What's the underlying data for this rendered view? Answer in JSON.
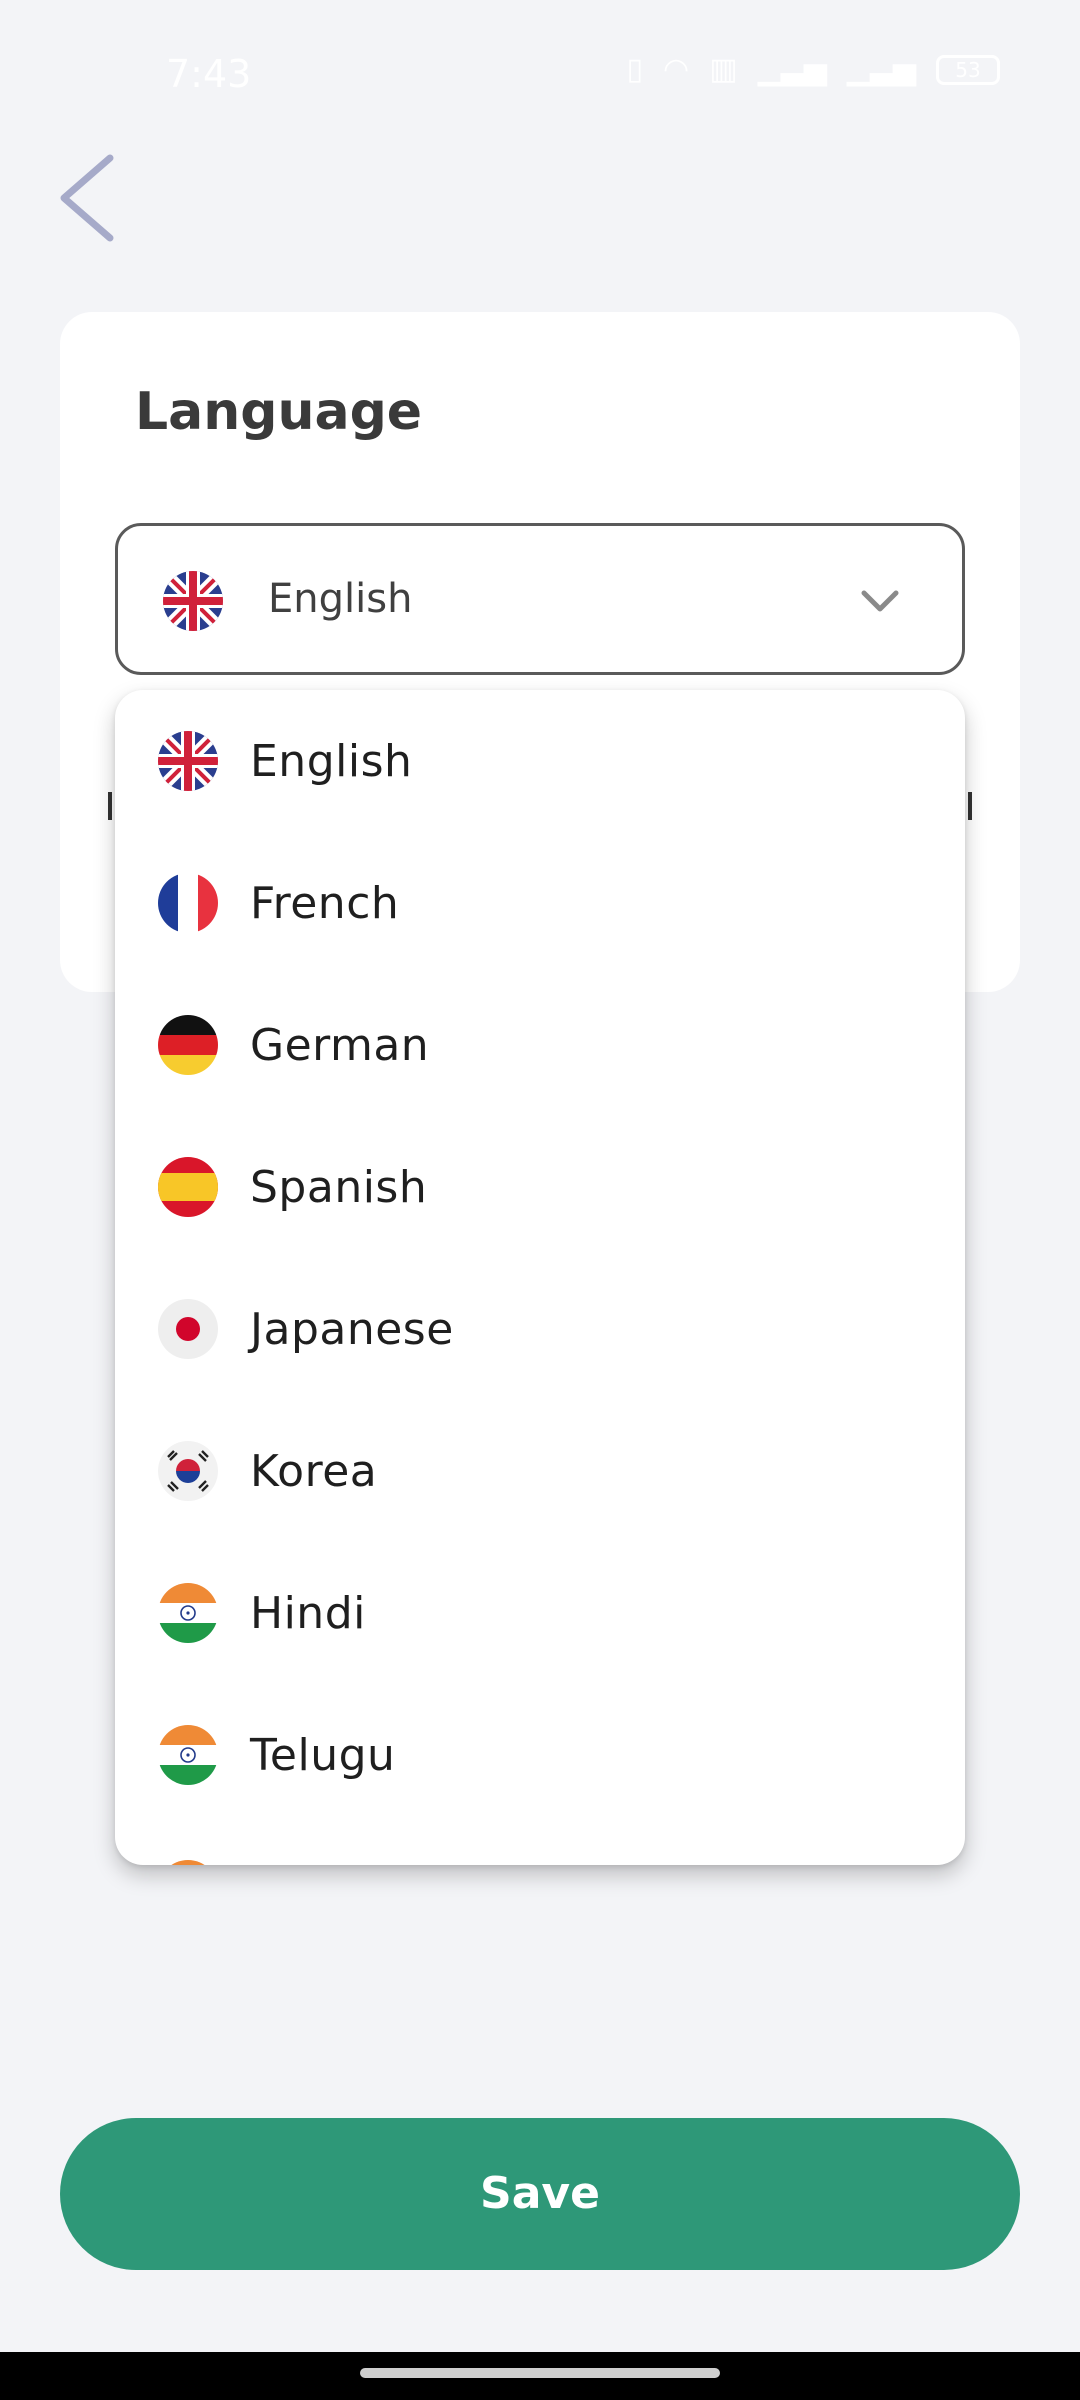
{
  "status_bar": {
    "time": "7:43",
    "icons": [
      "vibrate-icon",
      "wifi-icon",
      "data-icon",
      "signal-icon",
      "signal-icon"
    ],
    "battery": "53"
  },
  "page": {
    "title": "Language",
    "back_icon": "chevron-left-icon"
  },
  "select": {
    "selected_value": "English",
    "selected_flag": "uk-flag-icon"
  },
  "dropdown": {
    "options": [
      {
        "label": "English",
        "flag": "uk-flag-icon"
      },
      {
        "label": "French",
        "flag": "france-flag-icon"
      },
      {
        "label": "German",
        "flag": "germany-flag-icon"
      },
      {
        "label": "Spanish",
        "flag": "spain-flag-icon"
      },
      {
        "label": "Japanese",
        "flag": "japan-flag-icon"
      },
      {
        "label": "Korea",
        "flag": "korea-flag-icon"
      },
      {
        "label": "Hindi",
        "flag": "india-flag-icon"
      },
      {
        "label": "Telugu",
        "flag": "india-flag-icon"
      }
    ]
  },
  "actions": {
    "save_label": "Save"
  },
  "colors": {
    "background": "#f3f4f7",
    "primary": "#2e9878",
    "back_icon": "#a6aac9"
  }
}
